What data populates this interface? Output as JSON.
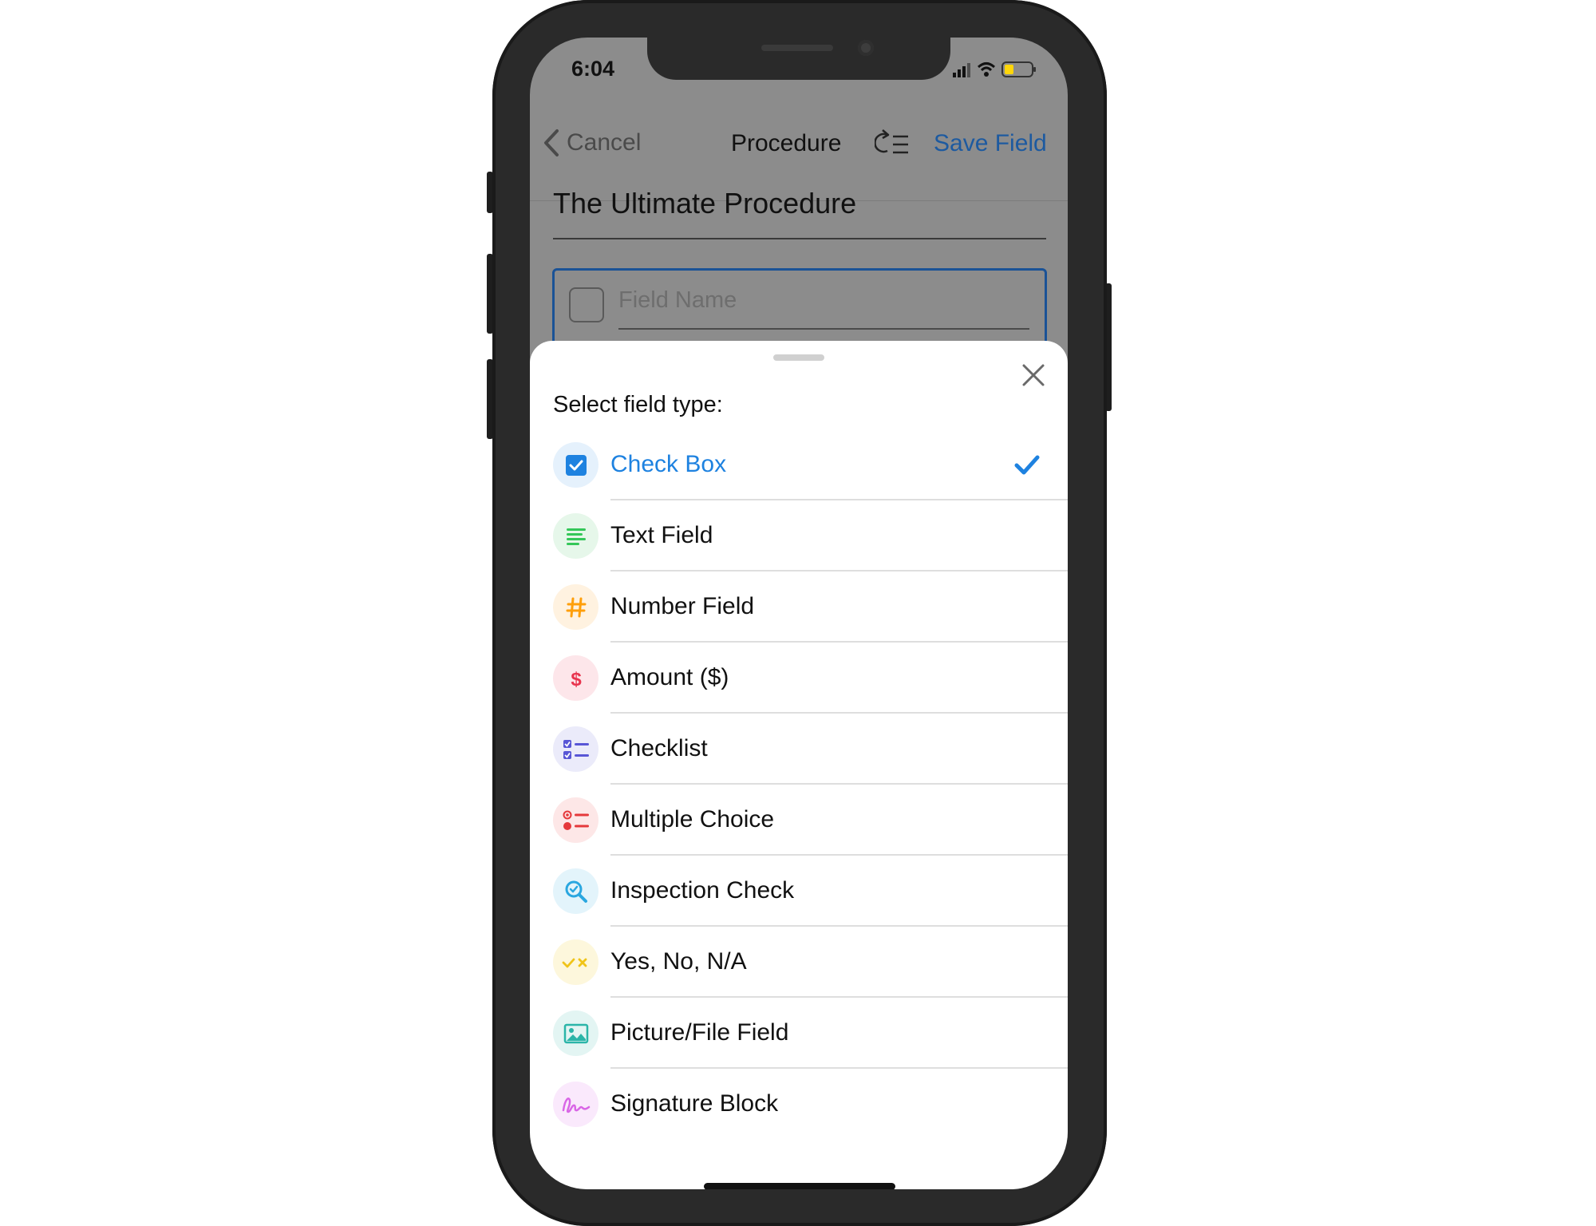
{
  "status_bar": {
    "time": "6:04"
  },
  "nav": {
    "cancel_label": "Cancel",
    "title": "Procedure",
    "save_label": "Save Field"
  },
  "procedure": {
    "title": "The Ultimate Procedure"
  },
  "field_editor": {
    "placeholder": "Field Name"
  },
  "sheet": {
    "title": "Select field type:",
    "items": [
      {
        "label": "Check Box",
        "icon": "checkbox-icon",
        "selected": true
      },
      {
        "label": "Text Field",
        "icon": "text-lines-icon"
      },
      {
        "label": "Number Field",
        "icon": "hash-icon"
      },
      {
        "label": "Amount ($)",
        "icon": "dollar-icon"
      },
      {
        "label": "Checklist",
        "icon": "checklist-icon"
      },
      {
        "label": "Multiple Choice",
        "icon": "multiple-choice-icon"
      },
      {
        "label": "Inspection Check",
        "icon": "magnifier-icon"
      },
      {
        "label": "Yes, No, N/A",
        "icon": "yes-no-icon"
      },
      {
        "label": "Picture/File Field",
        "icon": "picture-icon"
      },
      {
        "label": "Signature Block",
        "icon": "signature-icon"
      }
    ]
  },
  "colors": {
    "accent_blue": "#1e82e0",
    "save_blue": "#1d5aa0",
    "text_green": "#34c759",
    "number_orange": "#ff9f0a",
    "amount_red": "#e8344e",
    "checklist_indigo": "#5856d6",
    "choice_red": "#e5383b",
    "inspection_cyan": "#2aa7e0",
    "yesno_yellow": "#f0c419",
    "picture_teal": "#2bb5a8",
    "signature_pink": "#d966e6"
  }
}
